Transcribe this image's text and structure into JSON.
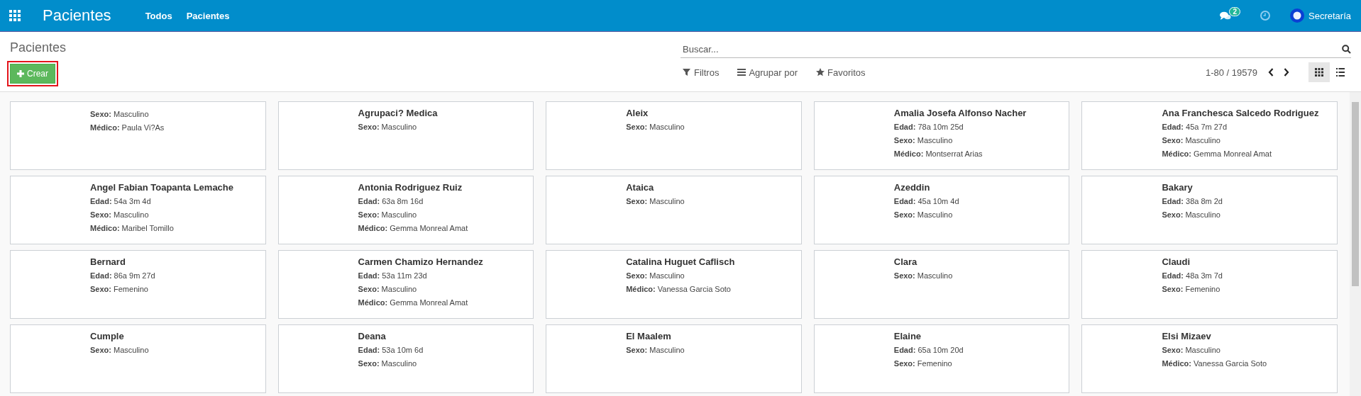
{
  "navbar": {
    "app_title": "Pacientes",
    "menu": [
      "Todos",
      "Pacientes"
    ],
    "messages_badge": "2",
    "user": "Secretaría"
  },
  "control_panel": {
    "breadcrumb": "Pacientes",
    "create_button": {
      "label": "Crear",
      "highlighted": true
    },
    "search": {
      "placeholder": "Buscar..."
    },
    "filters": [
      {
        "kind": "filter",
        "label": "Filtros"
      },
      {
        "kind": "group",
        "label": "Agrupar por"
      },
      {
        "kind": "favorite",
        "label": "Favoritos"
      }
    ],
    "pager": "1-80 / 19579",
    "views": [
      {
        "kind": "kanban",
        "selected": true
      },
      {
        "kind": "list",
        "selected": false
      }
    ]
  },
  "cards": [
    {
      "fields": [
        {
          "label": "Sexo:",
          "value": "Masculino"
        },
        {
          "label": "Médico:",
          "value": "Paula Vi?As"
        }
      ]
    },
    {
      "name": "Agrupaci? Medica",
      "fields": [
        {
          "label": "Sexo:",
          "value": "Masculino"
        }
      ]
    },
    {
      "name": "Aleix",
      "fields": [
        {
          "label": "Sexo:",
          "value": "Masculino"
        }
      ]
    },
    {
      "name": "Amalia Josefa Alfonso Nacher",
      "fields": [
        {
          "label": "Edad:",
          "value": "78a 10m 25d"
        },
        {
          "label": "Sexo:",
          "value": "Masculino"
        },
        {
          "label": "Médico:",
          "value": "Montserrat Arias"
        }
      ]
    },
    {
      "name": "Ana Franchesca Salcedo Rodriguez",
      "fields": [
        {
          "label": "Edad:",
          "value": "45a 7m 27d"
        },
        {
          "label": "Sexo:",
          "value": "Masculino"
        },
        {
          "label": "Médico:",
          "value": "Gemma Monreal Amat"
        }
      ]
    },
    {
      "name": "Angel Fabian Toapanta Lemache",
      "fields": [
        {
          "label": "Edad:",
          "value": "54a 3m 4d"
        },
        {
          "label": "Sexo:",
          "value": "Masculino"
        },
        {
          "label": "Médico:",
          "value": "Maribel Tomillo"
        }
      ]
    },
    {
      "name": "Antonia Rodriguez Ruiz",
      "fields": [
        {
          "label": "Edad:",
          "value": "63a 8m 16d"
        },
        {
          "label": "Sexo:",
          "value": "Masculino"
        },
        {
          "label": "Médico:",
          "value": "Gemma Monreal Amat"
        }
      ]
    },
    {
      "name": "Ataica",
      "fields": [
        {
          "label": "Sexo:",
          "value": "Masculino"
        }
      ]
    },
    {
      "name": "Azeddin",
      "fields": [
        {
          "label": "Edad:",
          "value": "45a 10m 4d"
        },
        {
          "label": "Sexo:",
          "value": "Masculino"
        }
      ]
    },
    {
      "name": "Bakary",
      "fields": [
        {
          "label": "Edad:",
          "value": "38a 8m 2d"
        },
        {
          "label": "Sexo:",
          "value": "Masculino"
        }
      ]
    },
    {
      "name": "Bernard",
      "fields": [
        {
          "label": "Edad:",
          "value": "86a 9m 27d"
        },
        {
          "label": "Sexo:",
          "value": "Femenino"
        }
      ]
    },
    {
      "name": "Carmen Chamizo Hernandez",
      "fields": [
        {
          "label": "Edad:",
          "value": "53a 11m 23d"
        },
        {
          "label": "Sexo:",
          "value": "Masculino"
        },
        {
          "label": "Médico:",
          "value": "Gemma Monreal Amat"
        }
      ]
    },
    {
      "name": "Catalina Huguet Caflisch",
      "fields": [
        {
          "label": "Sexo:",
          "value": "Masculino"
        },
        {
          "label": "Médico:",
          "value": "Vanessa Garcia Soto"
        }
      ]
    },
    {
      "name": "Clara",
      "fields": [
        {
          "label": "Sexo:",
          "value": "Masculino"
        }
      ]
    },
    {
      "name": "Claudi",
      "fields": [
        {
          "label": "Edad:",
          "value": "48a 3m 7d"
        },
        {
          "label": "Sexo:",
          "value": "Femenino"
        }
      ]
    },
    {
      "name": "Cumple",
      "fields": [
        {
          "label": "Sexo:",
          "value": "Masculino"
        }
      ]
    },
    {
      "name": "Deana",
      "fields": [
        {
          "label": "Edad:",
          "value": "53a 10m 6d"
        },
        {
          "label": "Sexo:",
          "value": "Masculino"
        }
      ]
    },
    {
      "name": "El Maalem",
      "fields": [
        {
          "label": "Sexo:",
          "value": "Masculino"
        }
      ]
    },
    {
      "name": "Elaine",
      "fields": [
        {
          "label": "Edad:",
          "value": "65a 10m 20d"
        },
        {
          "label": "Sexo:",
          "value": "Femenino"
        }
      ]
    },
    {
      "name": "Elsi Mizaev",
      "fields": [
        {
          "label": "Sexo:",
          "value": "Masculino"
        },
        {
          "label": "Médico:",
          "value": "Vanessa Garcia Soto"
        }
      ]
    }
  ]
}
